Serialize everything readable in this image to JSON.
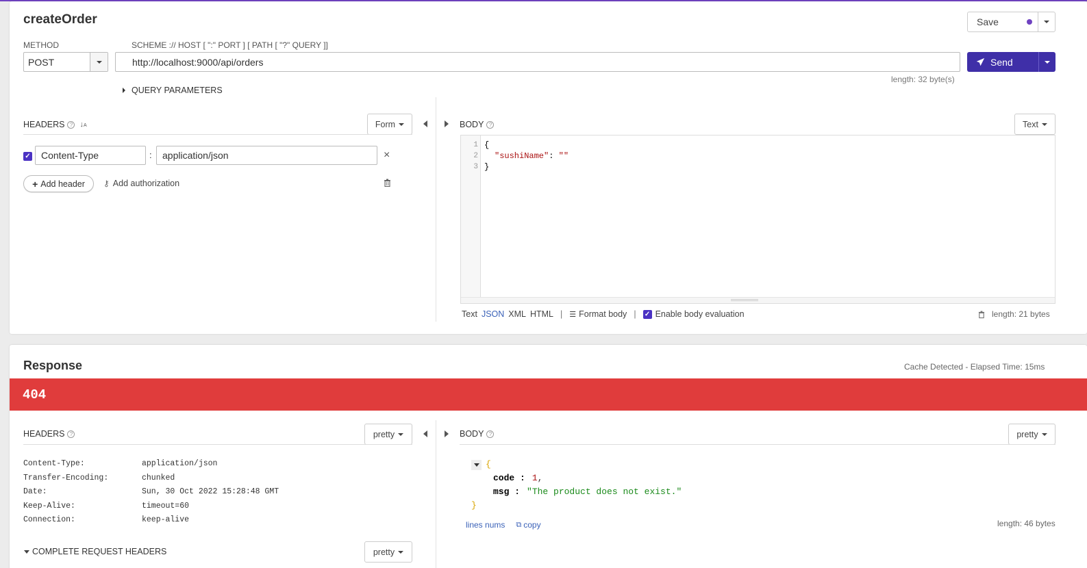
{
  "request": {
    "title": "createOrder",
    "save_label": "Save",
    "method_label": "METHOD",
    "method_value": "POST",
    "url_label": "SCHEME :// HOST [ \":\" PORT ] [ PATH [ \"?\" QUERY ]]",
    "url_value": "http://localhost:9000/api/orders",
    "url_length": "length: 32 byte(s)",
    "send_label": "Send",
    "query_params_label": "QUERY PARAMETERS",
    "headers_label": "HEADERS",
    "headers_mode": "Form",
    "headers": [
      {
        "name": "Content-Type",
        "value": "application/json",
        "enabled": true
      }
    ],
    "add_header_label": "Add header",
    "add_auth_label": "Add authorization",
    "body_label": "BODY",
    "body_mode": "Text",
    "body_lines": [
      {
        "num": "1",
        "text": "{"
      },
      {
        "num": "2",
        "key": "\"sushiName\"",
        "sep": ": ",
        "val": "\"\""
      },
      {
        "num": "3",
        "text": "}"
      }
    ],
    "body_formats": [
      "Text",
      "JSON",
      "XML",
      "HTML"
    ],
    "format_body_label": "Format body",
    "enable_eval_label": "Enable body evaluation",
    "body_length": "length: 21 bytes"
  },
  "response": {
    "title": "Response",
    "cache_info": "Cache Detected - Elapsed Time: 15ms",
    "status_code": "404",
    "status_color": "#e03c3c",
    "headers_label": "HEADERS",
    "headers_mode": "pretty",
    "headers": [
      {
        "name": "Content-Type:",
        "value": "application/json"
      },
      {
        "name": "Transfer-Encoding:",
        "value": "chunked"
      },
      {
        "name": "Date:",
        "value": "Sun, 30 Oct 2022 15:28:48 GMT"
      },
      {
        "name": "Keep-Alive:",
        "value": "timeout=60"
      },
      {
        "name": "Connection:",
        "value": "keep-alive"
      }
    ],
    "complete_headers_label": "COMPLETE REQUEST HEADERS",
    "complete_headers_mode": "pretty",
    "body_label": "BODY",
    "body_mode": "pretty",
    "body": {
      "open": "{",
      "close": "}",
      "fields": [
        {
          "key": "code",
          "colon": " :",
          "value": "1",
          "comma": ","
        },
        {
          "key": "msg",
          "colon": " :",
          "value": "\"The product does not exist.\"",
          "comma": ""
        }
      ]
    },
    "line_nums_label": "lines nums",
    "copy_label": "copy",
    "body_length": "length: 46 bytes"
  },
  "colors": {
    "accent": "#4b32c3",
    "send": "#3f2fa8",
    "error": "#e03c3c"
  }
}
